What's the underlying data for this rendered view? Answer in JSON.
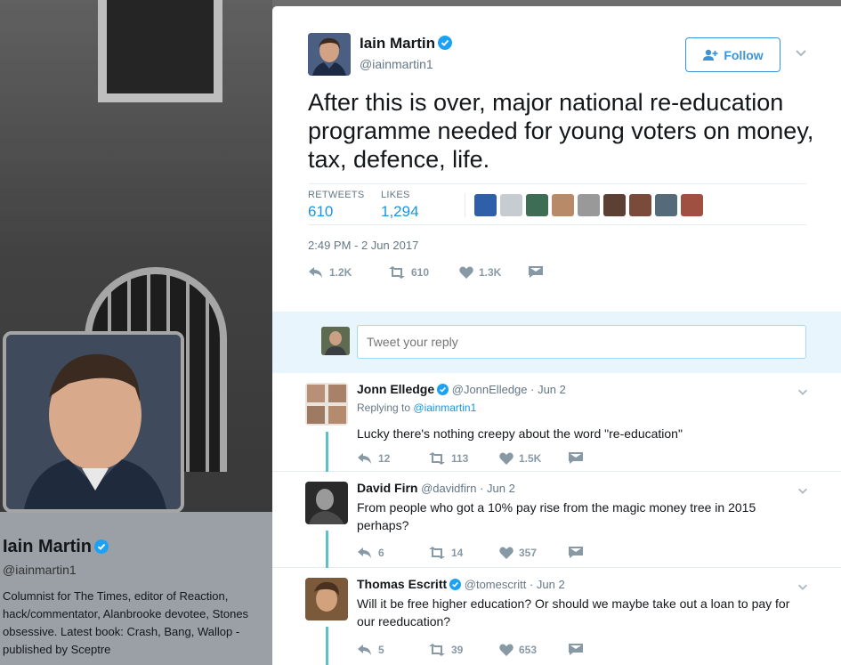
{
  "profile": {
    "name": "Iain Martin",
    "handle": "@iainmartin1",
    "bio": "Columnist for The Times, editor of Reaction, hack/commentator, Alanbrooke devotee, Stones obsessive. Latest book: Crash, Bang, Wallop - published by Sceptre"
  },
  "tweet": {
    "author_name": "Iain Martin",
    "author_handle": "@iainmartin1",
    "follow_label": "Follow",
    "text": "After this is over, major national re-education programme needed for young voters on money, tax, defence, life.",
    "retweets_label": "RETWEETS",
    "retweets_value": "610",
    "likes_label": "LIKES",
    "likes_value": "1,294",
    "timestamp": "2:49 PM - 2 Jun 2017",
    "actions": {
      "reply": "1.2K",
      "retweet": "610",
      "like": "1.3K"
    }
  },
  "reply_box": {
    "placeholder": "Tweet your reply"
  },
  "replies": [
    {
      "name": "Jonn Elledge",
      "handle": "@JonnElledge",
      "date": "· Jun 2",
      "replying_prefix": "Replying to",
      "replying_to": "@iainmartin1",
      "text": "Lucky there's nothing creepy about the word \"re-education\"",
      "reply_count": "12",
      "retweet_count": "113",
      "like_count": "1.5K"
    },
    {
      "name": "David Firn",
      "handle": "@davidfirn",
      "date": "· Jun 2",
      "text": "From people who got a 10% pay rise from the magic money tree in 2015 perhaps?",
      "reply_count": "6",
      "retweet_count": "14",
      "like_count": "357"
    },
    {
      "name": "Thomas Escritt",
      "handle": "@tomescritt",
      "date": "· Jun 2",
      "text": "Will it be free higher education? Or should we maybe take out a loan to pay for our reeducation?",
      "reply_count": "5",
      "retweet_count": "39",
      "like_count": "653"
    }
  ],
  "colors": {
    "accent": "#1b95e0",
    "verified": "#1da1f2",
    "thread": "#5fc1c7",
    "reply_bg": "#e8f5fd"
  }
}
